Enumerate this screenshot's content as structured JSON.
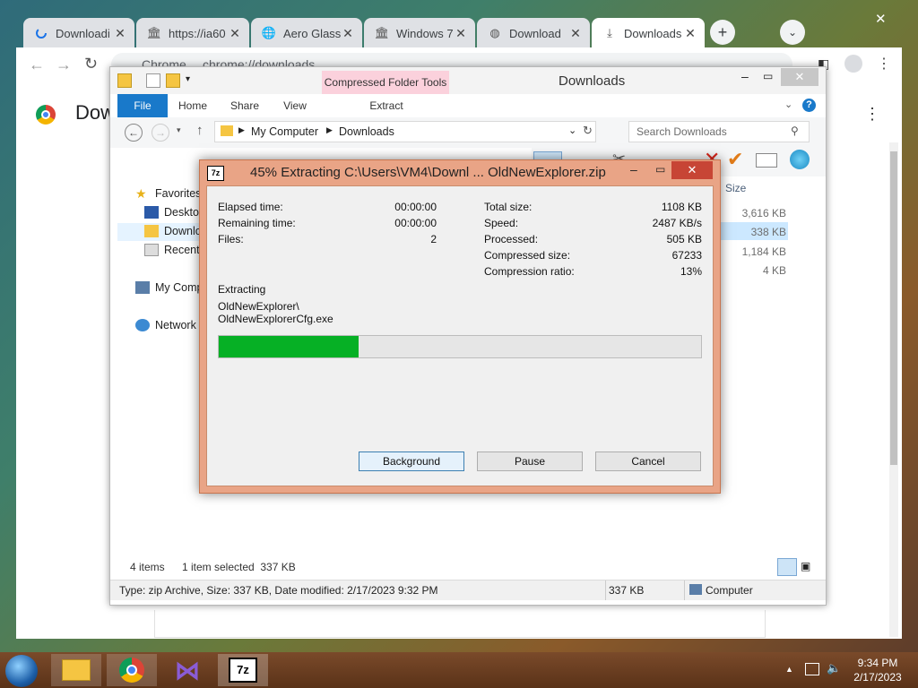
{
  "chrome": {
    "tabs": [
      {
        "label": "Downloadi",
        "icon": "loading-icon"
      },
      {
        "label": "https://ia60",
        "icon": "archive-icon"
      },
      {
        "label": "Aero Glass",
        "icon": "globe-icon"
      },
      {
        "label": "Windows 7",
        "icon": "archive-icon"
      },
      {
        "label": "Download",
        "icon": "site-icon"
      },
      {
        "label": "Downloads",
        "icon": "download-icon"
      }
    ],
    "omnibox_site": "Chrome",
    "omnibox_url": "chrome://downloads",
    "page_title": "Dow"
  },
  "explorer": {
    "title": "Downloads",
    "context_tab": "Compressed Folder Tools",
    "context_subtab": "Extract",
    "ribbon_tabs": [
      "File",
      "Home",
      "Share",
      "View"
    ],
    "breadcrumb": [
      "My Computer",
      "Downloads"
    ],
    "search_placeholder": "Search Downloads",
    "nav": {
      "favorites": "Favorites",
      "desktop": "Desktop",
      "downloads": "Downlo",
      "recent": "Recent p",
      "computer": "My Comp",
      "network": "Network"
    },
    "size_header": "Size",
    "sizes": [
      "3,616 KB",
      "338 KB",
      "1,184 KB",
      "4 KB"
    ],
    "status_items": "4 items",
    "status_selected": "1 item selected  337 KB",
    "details_text": "Type: zip Archive, Size: 337 KB, Date modified: 2/17/2023 9:32 PM",
    "details_size": "337 KB",
    "details_location": "Computer"
  },
  "dialog": {
    "title": "45% Extracting C:\\Users\\VM4\\Downl ... OldNewExplorer.zip",
    "app_icon": "7z",
    "left": [
      {
        "label": "Elapsed time:",
        "value": "00:00:00"
      },
      {
        "label": "Remaining time:",
        "value": "00:00:00"
      },
      {
        "label": "Files:",
        "value": "2"
      }
    ],
    "right": [
      {
        "label": "Total size:",
        "value": "1108 KB"
      },
      {
        "label": "Speed:",
        "value": "2487 KB/s"
      },
      {
        "label": "Processed:",
        "value": "505 KB"
      },
      {
        "label": "Compressed size:",
        "value": "67233"
      },
      {
        "label": "Compression ratio:",
        "value": "13%"
      }
    ],
    "status": "Extracting",
    "file_line1": "OldNewExplorer\\",
    "file_line2": "OldNewExplorerCfg.exe",
    "progress": 0.29,
    "buttons": {
      "background": "Background",
      "pause": "Pause",
      "cancel": "Cancel"
    }
  },
  "taskbar": {
    "time": "9:34 PM",
    "date": "2/17/2023"
  },
  "colors": {
    "progress": "#06b025",
    "dialog_frame": "#e9a486",
    "context_tab": "#fbd1dc",
    "file_tab": "#1979ca"
  }
}
